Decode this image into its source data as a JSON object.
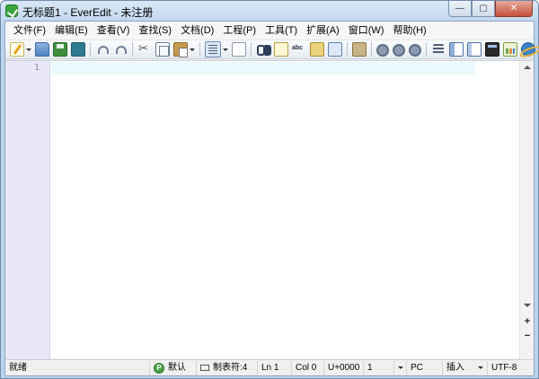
{
  "window": {
    "title": "无标题1 - EverEdit - 未注册",
    "caption": {
      "minimize": "—",
      "maximize": "▢",
      "close": "✕"
    }
  },
  "menu": [
    "文件(F)",
    "编辑(E)",
    "查看(V)",
    "查找(S)",
    "文档(D)",
    "工程(P)",
    "工具(T)",
    "扩展(A)",
    "窗口(W)",
    "帮助(H)"
  ],
  "toolbar": {
    "icons": [
      "new-file-icon",
      "open-folder-icon",
      "save-icon",
      "save-all-icon",
      "undo-icon",
      "redo-icon",
      "cut-icon",
      "copy-icon",
      "paste-icon",
      "word-wrap-icon",
      "line-numbers-icon",
      "find-icon",
      "edit-icon",
      "spell-check-icon",
      "find-in-files-icon",
      "replace-icon",
      "tools-icon",
      "gear-icon",
      "list-icon",
      "left-panel-icon",
      "right-panel-icon",
      "console-icon",
      "chart-icon",
      "browser-icon",
      "help-icon"
    ]
  },
  "editor": {
    "line_number": "1",
    "current_line_color": "#eafafc",
    "gutter_color": "#e8e8f8"
  },
  "scrollbar": {
    "zoom_in": "+",
    "zoom_out": "−"
  },
  "status": {
    "ready": "就绪",
    "scheme": "默认",
    "scheme_badge": "P",
    "tab": "制表符:4",
    "ln": "Ln 1",
    "col": "Col 0",
    "unicode": "U+0000",
    "selection": "1",
    "eol": "PC",
    "insert": "插入",
    "encoding": "UTF-8"
  }
}
